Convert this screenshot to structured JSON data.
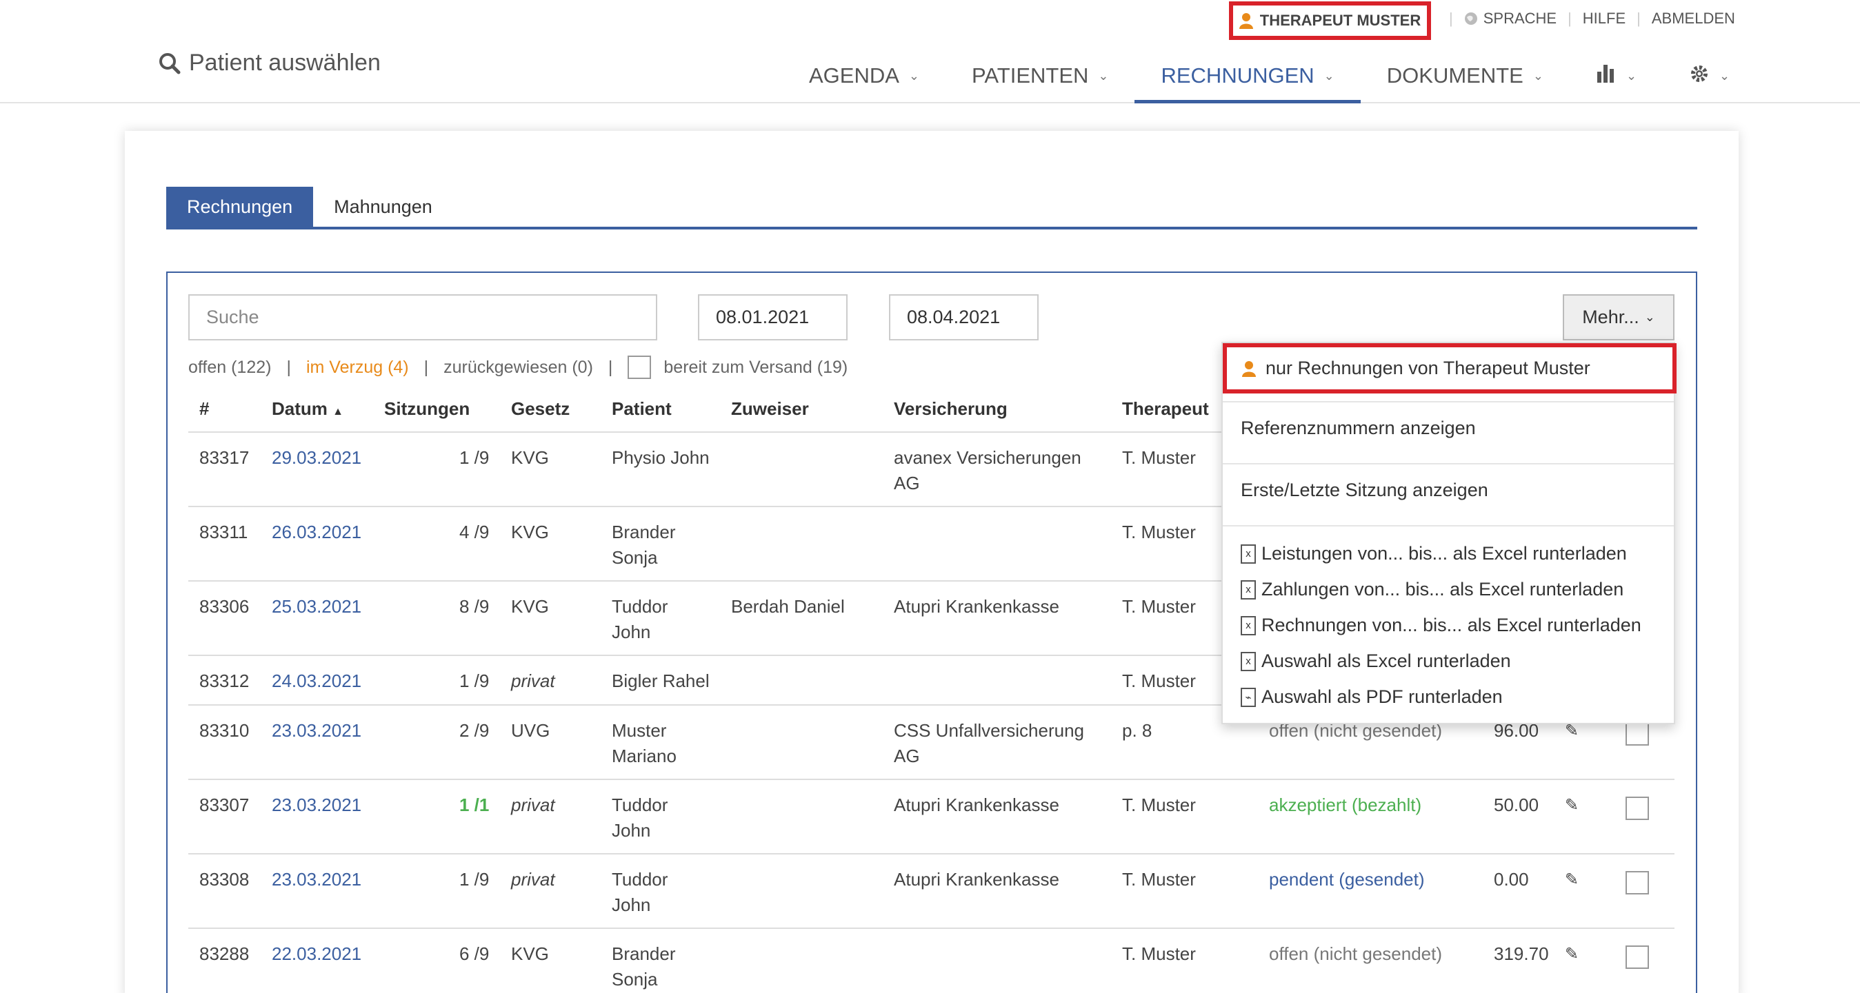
{
  "header": {
    "user": "THERAPEUT MUSTER",
    "language": "SPRACHE",
    "help": "HILFE",
    "logout": "ABMELDEN",
    "patient_select": "Patient auswählen",
    "nav": [
      {
        "label": "AGENDA"
      },
      {
        "label": "PATIENTEN"
      },
      {
        "label": "RECHNUNGEN",
        "active": true
      },
      {
        "label": "DOKUMENTE"
      }
    ]
  },
  "tabs": [
    {
      "label": "Rechnungen",
      "active": true
    },
    {
      "label": "Mahnungen"
    }
  ],
  "toolbar": {
    "search_placeholder": "Suche",
    "date_from": "08.01.2021",
    "date_to": "08.04.2021",
    "more_label": "Mehr..."
  },
  "filters": {
    "open": "offen (122)",
    "overdue": "im Verzug (4)",
    "rejected": "zurückgewiesen (0)",
    "ready": "bereit zum Versand (19)"
  },
  "table": {
    "headers": [
      "#",
      "Datum",
      "Sitzungen",
      "Gesetz",
      "Patient",
      "Zuweiser",
      "Versicherung",
      "Therapeut"
    ],
    "rows": [
      {
        "nr": "83317",
        "date": "29.03.2021",
        "sessions": "1 /9",
        "law": "KVG",
        "patient1": "Physio John",
        "patient2": "",
        "referrer": "",
        "insurance1": "avanex Versicherungen",
        "insurance2": "AG",
        "therapist": "T. Muster",
        "status": "",
        "amount": ""
      },
      {
        "nr": "83311",
        "date": "26.03.2021",
        "sessions": "4 /9",
        "law": "KVG",
        "patient1": "Brander",
        "patient2": "Sonja",
        "referrer": "",
        "insurance1": "",
        "insurance2": "",
        "therapist": "T. Muster",
        "status": "",
        "amount": ""
      },
      {
        "nr": "83306",
        "date": "25.03.2021",
        "sessions": "8 /9",
        "law": "KVG",
        "patient1": "Tuddor",
        "patient2": "John",
        "referrer": "Berdah Daniel",
        "insurance1": "Atupri Krankenkasse",
        "insurance2": "",
        "therapist": "T. Muster",
        "status": "",
        "amount": ""
      },
      {
        "nr": "83312",
        "date": "24.03.2021",
        "sessions": "1 /9",
        "law": "privat",
        "patient1": "Bigler Rahel",
        "patient2": "",
        "referrer": "",
        "insurance1": "",
        "insurance2": "",
        "therapist": "T. Muster",
        "status": "",
        "amount": ""
      },
      {
        "nr": "83310",
        "date": "23.03.2021",
        "sessions": "2 /9",
        "law": "UVG",
        "patient1": "Muster",
        "patient2": "Mariano",
        "referrer": "",
        "insurance1": "CSS Unfallversicherung",
        "insurance2": "AG",
        "therapist": "p. 8",
        "status": "offen (nicht gesendet)",
        "amount": "96.00"
      },
      {
        "nr": "83307",
        "date": "23.03.2021",
        "sessions": "1 /1",
        "law": "privat",
        "patient1": "Tuddor",
        "patient2": "John",
        "referrer": "",
        "insurance1": "Atupri Krankenkasse",
        "insurance2": "",
        "therapist": "T. Muster",
        "status": "akzeptiert (bezahlt)",
        "amount": "50.00"
      },
      {
        "nr": "83308",
        "date": "23.03.2021",
        "sessions": "1 /9",
        "law": "privat",
        "patient1": "Tuddor",
        "patient2": "John",
        "referrer": "",
        "insurance1": "Atupri Krankenkasse",
        "insurance2": "",
        "therapist": "T. Muster",
        "status": "pendent (gesendet)",
        "amount": "0.00"
      },
      {
        "nr": "83288",
        "date": "22.03.2021",
        "sessions": "6 /9",
        "law": "KVG",
        "patient1": "Brander",
        "patient2": "Sonja",
        "referrer": "",
        "insurance1": "",
        "insurance2": "",
        "therapist": "T. Muster",
        "status": "offen (nicht gesendet)",
        "amount": "319.70"
      }
    ]
  },
  "dropdown": {
    "only_mine": "nur Rechnungen von Therapeut Muster",
    "show_refs": "Referenznummern anzeigen",
    "show_first_last": "Erste/Letzte Sitzung anzeigen",
    "dl_services": "Leistungen von... bis... als Excel runterladen",
    "dl_payments": "Zahlungen von... bis... als Excel runterladen",
    "dl_invoices": "Rechnungen von... bis... als Excel runterladen",
    "dl_sel_excel": "Auswahl als Excel runterladen",
    "dl_sel_pdf": "Auswahl als PDF runterladen"
  },
  "colors": {
    "accent": "#3b5fa0",
    "highlight": "#d9222a",
    "user_icon": "#e88a1a",
    "paid": "#4caf50"
  }
}
